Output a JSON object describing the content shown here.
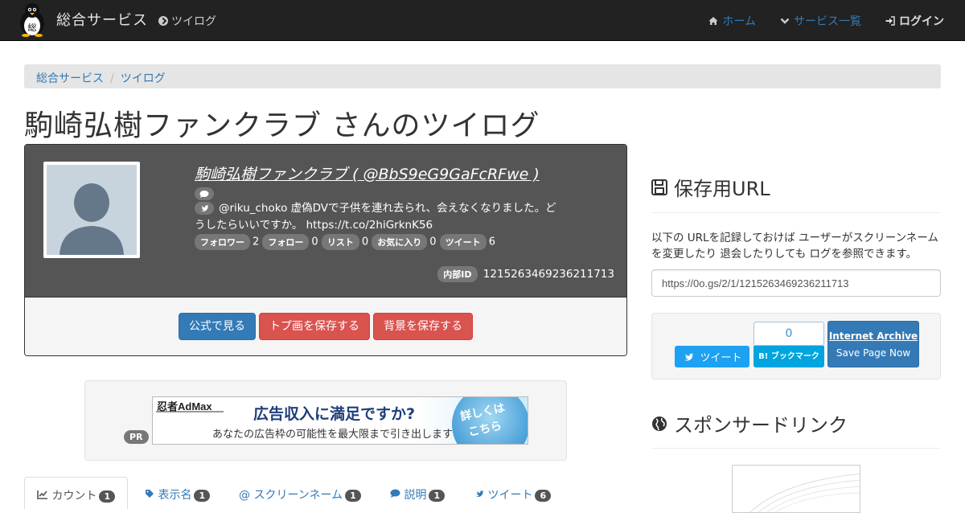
{
  "navbar": {
    "brand": "総合サービス",
    "left_link": "ツイログ",
    "right": {
      "home": "ホーム",
      "services": "サービス一覧",
      "login": "ログイン"
    }
  },
  "breadcrumb": {
    "items": [
      "総合サービス",
      "ツイログ"
    ]
  },
  "page": {
    "title": "駒崎弘樹ファンクラブ さんのツイログ"
  },
  "profile": {
    "name_link": "駒崎弘樹ファンクラブ ( @BbS9eG9GaFcRFwe )",
    "description": "@riku_choko 虚偽DVで子供を連れ去られ、会えなくなりました。どうしたらいいですか。 https://t.co/2hiGrknK56",
    "stats": [
      {
        "label": "フォロワー",
        "value": "2"
      },
      {
        "label": "フォロー",
        "value": "0"
      },
      {
        "label": "リスト",
        "value": "0"
      },
      {
        "label": "お気に入り",
        "value": "0"
      },
      {
        "label": "ツイート",
        "value": "6"
      }
    ],
    "internal_id_label": "内部ID",
    "internal_id": "1215263469236211713",
    "buttons": {
      "official": "公式で見る",
      "save_avatar": "トプ画を保存する",
      "save_background": "背景を保存する"
    }
  },
  "ad": {
    "pr_label": "PR",
    "brand": "忍者AdMax",
    "headline": "広告収入に満足ですか?",
    "sub": "あなたの広告枠の可能性を最大限まで引き出します",
    "cta_line1": "詳しくは",
    "cta_line2": "こちら"
  },
  "tabs": [
    {
      "label": "カウント",
      "count": "1",
      "icon": "line-chart-icon"
    },
    {
      "label": "表示名",
      "count": "1",
      "icon": "tag-icon"
    },
    {
      "label": "スクリーンネーム",
      "count": "1",
      "icon": "at-icon"
    },
    {
      "label": "説明",
      "count": "1",
      "icon": "comment-icon"
    },
    {
      "label": "ツイート",
      "count": "6",
      "icon": "twitter-icon"
    }
  ],
  "sidebar": {
    "save_url_title": "保存用URL",
    "save_url_desc": "以下の URLを記録しておけば ユーザーがスクリーンネームを変更したり 退会したりしても ログを参照できます。",
    "save_url_value": "https://0o.gs/2/1/1215263469236211713",
    "tweet_button": "ツイート",
    "hatena_count": "0",
    "hatena_label": "B! ブックマーク",
    "ia_title": "Internet Archive",
    "ia_sub": "Save Page Now",
    "sponsored_title": "スポンサードリンク"
  },
  "colors": {
    "navbar": "#222222",
    "primary": "#337ab7",
    "danger": "#d9534f",
    "panel_dark": "#555555"
  }
}
